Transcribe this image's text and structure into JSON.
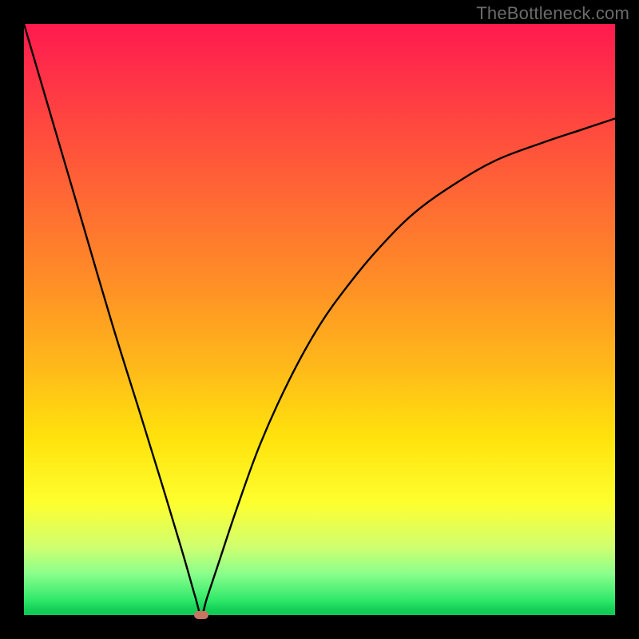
{
  "watermark": "TheBottleneck.com",
  "chart_data": {
    "type": "line",
    "title": "",
    "xlabel": "",
    "ylabel": "",
    "xlim": [
      0,
      100
    ],
    "ylim": [
      0,
      100
    ],
    "grid": false,
    "marker": {
      "x": 30,
      "y": 0,
      "shape": "pill",
      "color": "#c77463"
    },
    "series": [
      {
        "name": "curve",
        "color": "#000000",
        "x": [
          0,
          5,
          10,
          15,
          20,
          24,
          27,
          29,
          30,
          31,
          33,
          36,
          40,
          45,
          50,
          55,
          60,
          66,
          73,
          80,
          88,
          94,
          100
        ],
        "y": [
          100,
          83,
          66,
          49,
          33,
          20,
          10,
          3,
          0,
          3,
          9,
          18,
          29,
          40,
          49,
          56,
          62,
          68,
          73,
          77,
          80,
          82,
          84
        ]
      }
    ],
    "background_gradient": {
      "direction": "top-to-bottom",
      "stops": [
        {
          "pos": 0,
          "color": "#ff1a4e"
        },
        {
          "pos": 0.3,
          "color": "#ff6a33"
        },
        {
          "pos": 0.58,
          "color": "#ffb91a"
        },
        {
          "pos": 0.81,
          "color": "#feff2e"
        },
        {
          "pos": 0.93,
          "color": "#8aff8c"
        },
        {
          "pos": 1.0,
          "color": "#0ecb55"
        }
      ]
    }
  }
}
